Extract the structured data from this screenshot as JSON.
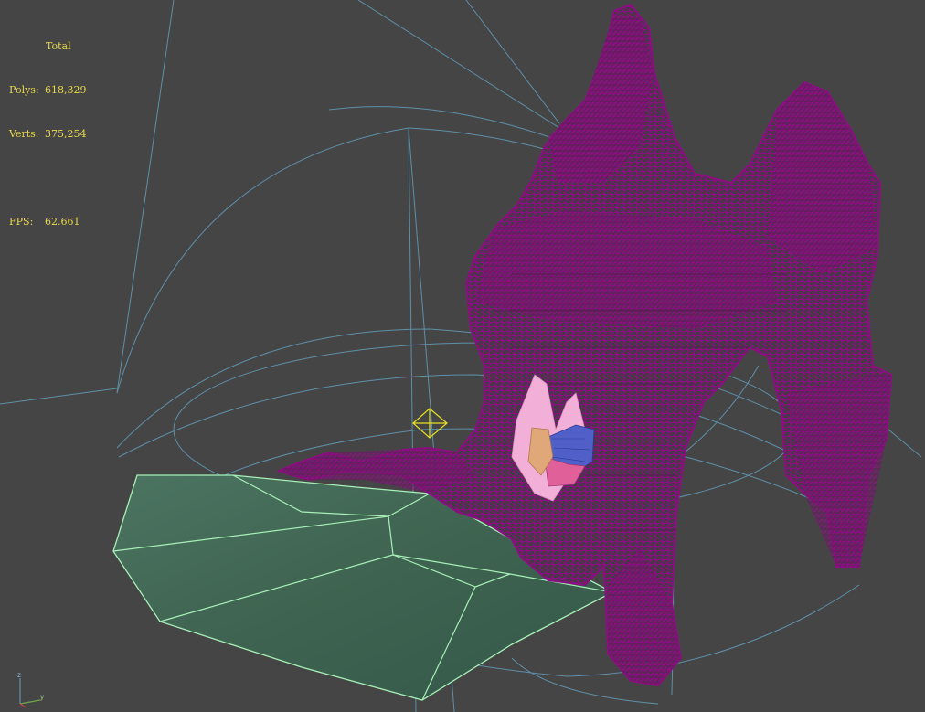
{
  "stats": {
    "header": "Total",
    "polys_label": "Polys:",
    "polys_value": "618,329",
    "verts_label": "Verts:",
    "verts_value": "375,254",
    "fps_label": "FPS:",
    "fps_value": "62.661"
  },
  "axis": {
    "z": "z",
    "y": "y"
  },
  "colors": {
    "background": "#454545",
    "stats_text": "#e8d84a",
    "wireframe_mesh": "#8b0f80",
    "bounding_lines": "#5e8fa8",
    "ground_fill": "#3f6652",
    "ground_edges": "#a8f0b8",
    "pink_object": "#f2b0d8",
    "blue_object": "#5060c8",
    "light_gizmo": "#e8e020"
  }
}
